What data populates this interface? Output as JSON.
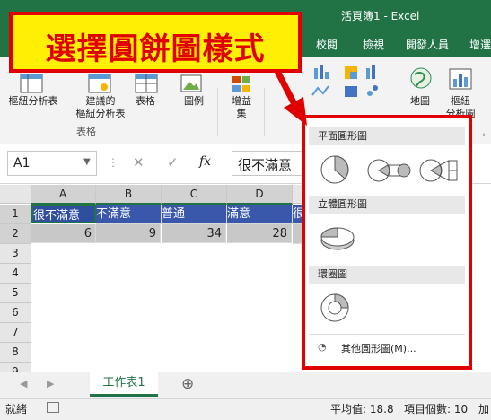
{
  "window": {
    "title": "活頁簿1  -  Excel"
  },
  "tabs": [
    "校閱",
    "檢視",
    "開發人員",
    "增選"
  ],
  "ribbon": {
    "tables_group": {
      "group_label": "表格",
      "buttons": [
        "樞紐分析表",
        "建議的\n樞紐分析表",
        "表格"
      ]
    },
    "illustrations": {
      "label": "圖例"
    },
    "addins": {
      "label": "增益\n集"
    },
    "map": {
      "label": "地圖"
    },
    "pivotchart": {
      "label": "樞紐\n分析圖"
    }
  },
  "formula_bar": {
    "name_box": "A1",
    "fx_symbol": "fx",
    "cancel_symbol": "✕",
    "enter_symbol": "✓",
    "content": "很不滿意"
  },
  "grid": {
    "columns": [
      "A",
      "B",
      "C",
      "D"
    ],
    "rows": [
      "1",
      "2",
      "3",
      "4",
      "5",
      "6",
      "7",
      "8",
      "9"
    ],
    "row1": [
      "很不滿意",
      "不滿意",
      "普通",
      "滿意",
      "很"
    ],
    "row2": [
      "6",
      "9",
      "34",
      "28",
      ""
    ]
  },
  "sheets": {
    "active": "工作表1",
    "add_symbol": "⊕"
  },
  "status": {
    "ready": "就緒",
    "average": "平均值: 18.8",
    "count": "項目個數: 10",
    "more": "加"
  },
  "callout": {
    "text": "選擇圓餅圖樣式"
  },
  "pie_menu": {
    "section_2d": "平面圓形圖",
    "section_3d": "立體圓形圖",
    "section_doughnut": "環圈圖",
    "more": "其他圓形圖(M)..."
  },
  "colors": {
    "excel_green": "#217346",
    "highlight_blue": "#2f4ea0",
    "callout_red": "#e00000",
    "callout_yellow": "#ffef05"
  }
}
